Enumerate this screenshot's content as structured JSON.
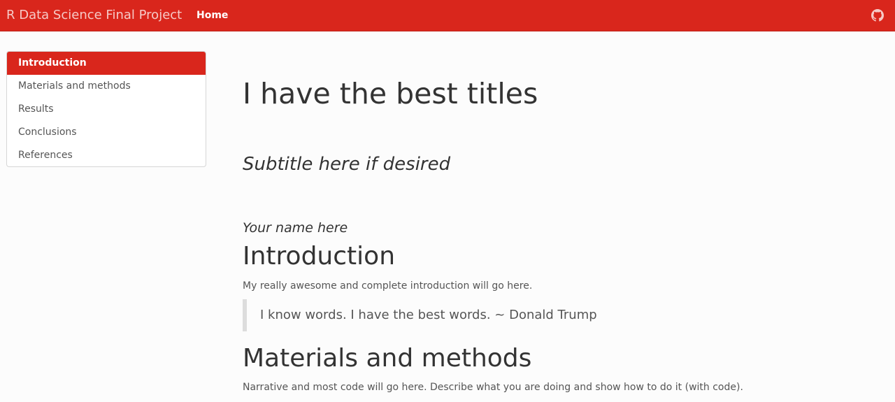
{
  "navbar": {
    "brand": "R Data Science Final Project",
    "home_label": "Home",
    "github_icon": "github-icon",
    "background_color": "#d9261c"
  },
  "toc": {
    "items": [
      {
        "label": "Introduction",
        "active": true
      },
      {
        "label": "Materials and methods",
        "active": false
      },
      {
        "label": "Results",
        "active": false
      },
      {
        "label": "Conclusions",
        "active": false
      },
      {
        "label": "References",
        "active": false
      }
    ]
  },
  "main": {
    "title": "I have the best titles",
    "subtitle": "Subtitle here if desired",
    "author": "Your name here",
    "sections": [
      {
        "heading": "Introduction",
        "text": "My really awesome and complete introduction will go here.",
        "quote": "I know words. I have the best words. ~ Donald Trump"
      },
      {
        "heading": "Materials and methods",
        "text": "Narrative and most code will go here. Describe what you are doing and show how to do it (with code)."
      }
    ]
  }
}
